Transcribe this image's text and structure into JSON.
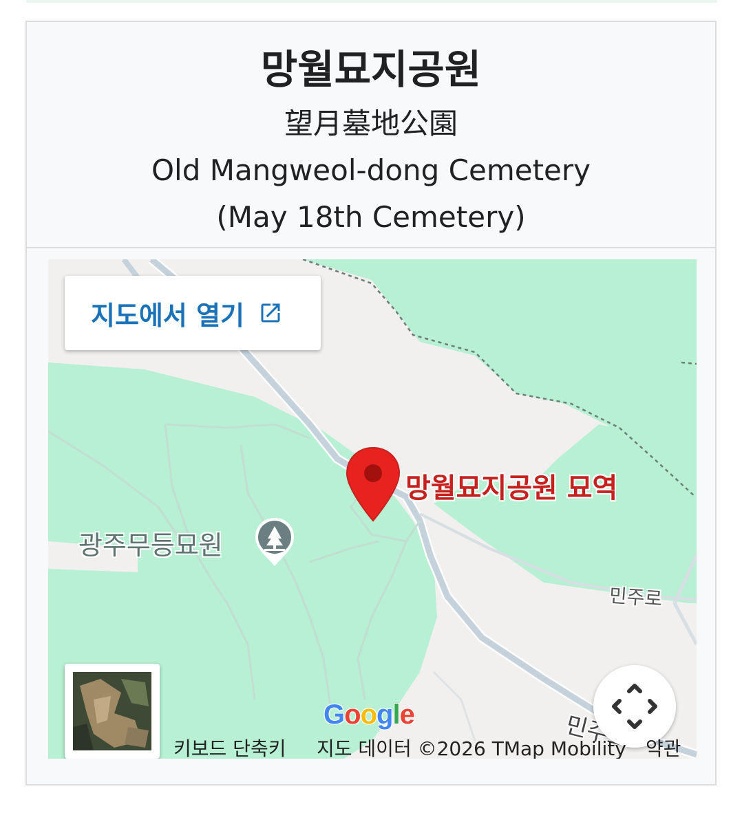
{
  "header": {
    "title": "망월묘지공원",
    "hanja": "望月墓地公園",
    "english_line1": "Old Mangweol-dong Cemetery",
    "english_line2": "(May 18th Cemetery)"
  },
  "map": {
    "open_in_maps_label": "지도에서 열기",
    "pin_label": "망월묘지공원 묘역",
    "poi_label": "광주무등묘원",
    "road_label_1": "민주로",
    "road_label_2": "민주로",
    "logo_text": "Google",
    "attribution": {
      "keyboard_shortcuts": "키보드 단축키",
      "map_data": "지도 데이터 ©2026 TMap Mobility",
      "terms": "약관"
    },
    "colors": {
      "park_green": "#b7f0d2",
      "base": "#f1f0ee",
      "road": "#c5d2dc",
      "pin_red": "#e8231f",
      "link_blue": "#1a73b8"
    },
    "icons": {
      "external_link": "open-in-new-icon",
      "fullscreen": "fullscreen-arrows-icon",
      "poi": "tree-icon"
    }
  }
}
